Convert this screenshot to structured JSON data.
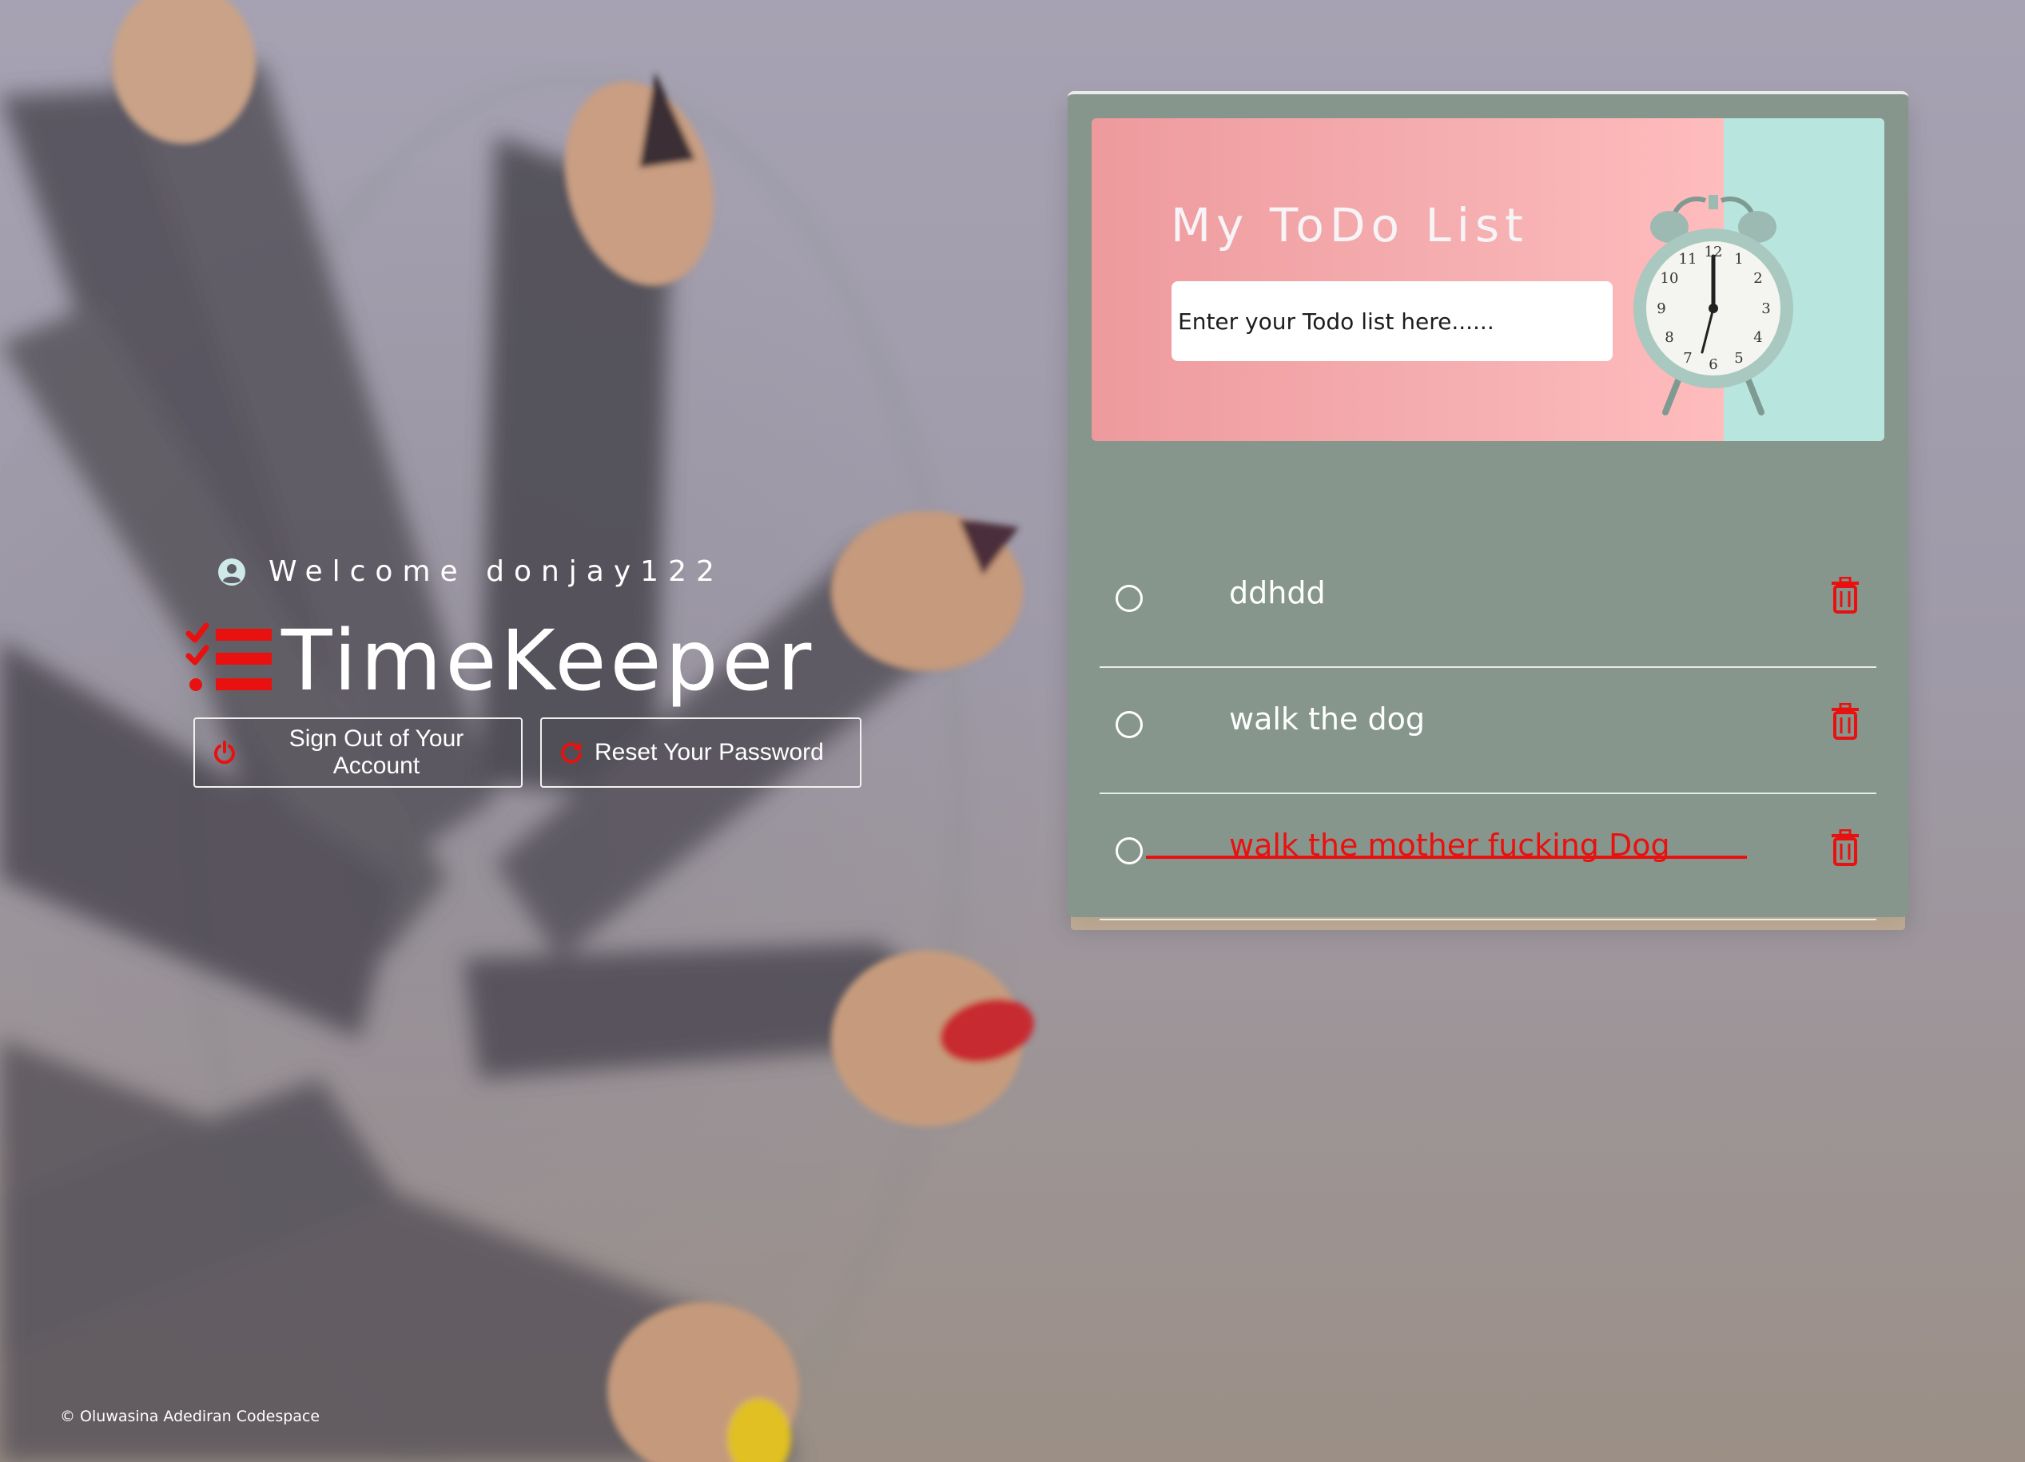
{
  "header": {
    "welcome_text": "Welcome donjay122",
    "user_icon": "user-circle-icon",
    "brand_name": "TimeKeeper",
    "brand_logo_icon": "checklist-icon"
  },
  "actions": {
    "sign_out_label": "Sign Out of Your Account",
    "sign_out_icon": "power-icon",
    "reset_label": "Reset Your Password",
    "reset_icon": "redo-icon"
  },
  "todo": {
    "title": "My ToDo List",
    "input_placeholder": "Enter your Todo list here......",
    "items": [
      {
        "text": "ddhdd",
        "completed": false
      },
      {
        "text": "walk the dog",
        "completed": false
      },
      {
        "text": "walk the mother fucking Dog",
        "completed": true
      }
    ],
    "delete_icon": "trash-icon",
    "check_icon": "circle-icon"
  },
  "footer": {
    "copyright": "© Oluwasina Adediran Codespace"
  },
  "colors": {
    "accent": "#e8110f",
    "card": "#86968c",
    "banner_pink": "#f6b0b2",
    "banner_mint": "#b8e5dd"
  }
}
